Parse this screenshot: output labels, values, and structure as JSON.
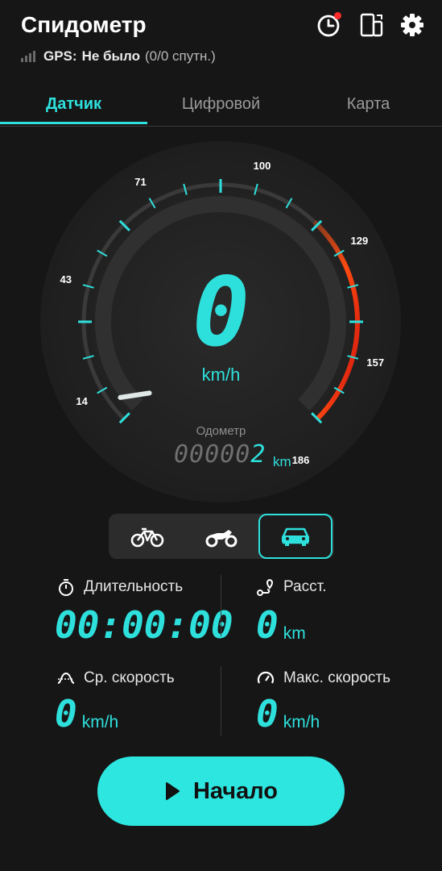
{
  "header": {
    "title": "Спидометр",
    "gps_label": "GPS:",
    "gps_status": "Не было",
    "gps_sats": "(0/0 спутн.)"
  },
  "icons": {
    "history": "history-clock-icon",
    "screen": "screen-rotate-icon",
    "settings": "gear-icon"
  },
  "tabs": [
    "Датчик",
    "Цифровой",
    "Карта"
  ],
  "active_tab": "Датчик",
  "gauge": {
    "tick_labels": [
      "14",
      "43",
      "71",
      "100",
      "129",
      "157",
      "186"
    ],
    "speed": "0",
    "speed_unit": "km/h",
    "odometer_label": "Одометр",
    "odometer_prefix": "00000",
    "odometer_last": "2",
    "odometer_unit": "km",
    "accent": "#2ee0dc",
    "warning": "#ff4a1a"
  },
  "vehicles": [
    {
      "name": "bicycle-icon",
      "selected": false
    },
    {
      "name": "motorcycle-icon",
      "selected": false
    },
    {
      "name": "car-icon",
      "selected": true
    }
  ],
  "stats": {
    "duration_label": "Длительность",
    "duration_value": "00:00:00",
    "distance_label": "Расст.",
    "distance_value": "0",
    "distance_unit": "km",
    "avg_label": "Ср. скорость",
    "avg_value": "0",
    "avg_unit": "km/h",
    "max_label": "Макс. скорость",
    "max_value": "0",
    "max_unit": "km/h"
  },
  "start_button": "Начало"
}
